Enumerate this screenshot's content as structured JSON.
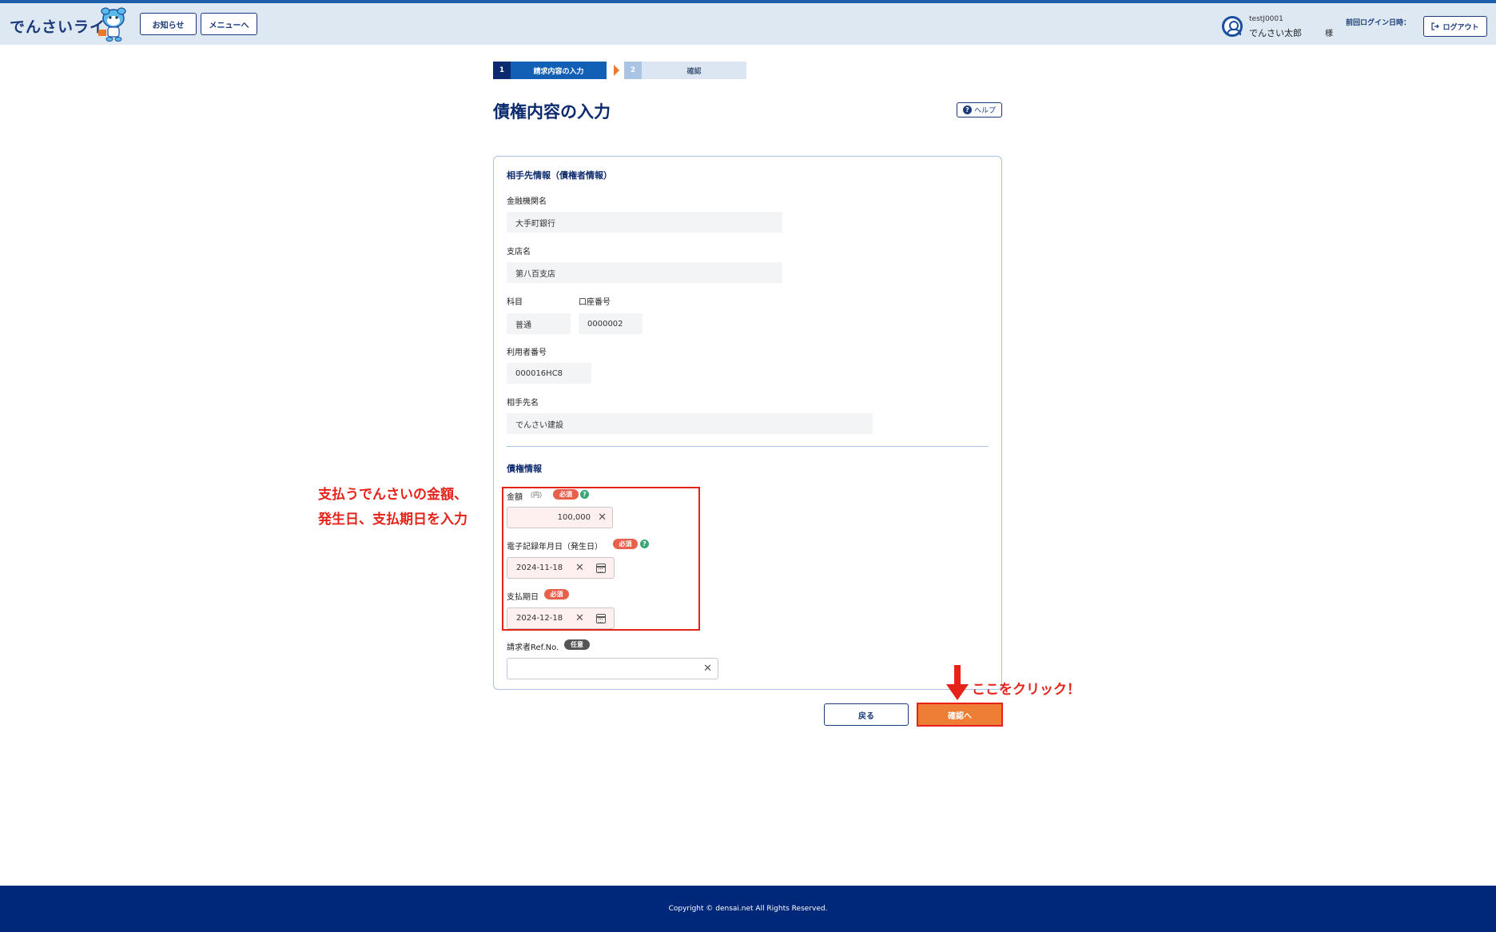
{
  "header": {
    "logo": "でんさいライト",
    "notice_button": "お知らせ",
    "menu_button": "メニューへ",
    "user_id": "testJ0001",
    "user_name": "でんさい太郎",
    "honorific": "様",
    "last_login_label": "前回ログイン日時：",
    "logout_button": "ログアウト"
  },
  "stepper": {
    "step1_num": "1",
    "step1_label": "請求内容の入力",
    "step2_num": "2",
    "step2_label": "確認"
  },
  "page": {
    "title": "債権内容の入力",
    "help_button": "ヘルプ"
  },
  "counterparty": {
    "section_title": "相手先情報（債権者情報）",
    "bank_label": "金融機関名",
    "bank_value": "大手町銀行",
    "branch_label": "支店名",
    "branch_value": "第八百支店",
    "account_type_label": "科目",
    "account_type_value": "普通",
    "account_number_label": "口座番号",
    "account_number_value": "0000002",
    "user_number_label": "利用者番号",
    "user_number_value": "000016HC8",
    "name_label": "相手先名",
    "name_value": "でんさい建設"
  },
  "claim": {
    "section_title": "債権情報",
    "amount_label": "金額",
    "amount_unit": "（円）",
    "amount_value": "100,000",
    "record_date_label": "電子記録年月日（発生日）",
    "record_date_value": "2024-11-18",
    "due_date_label": "支払期日",
    "due_date_value": "2024-12-18",
    "ref_label": "請求者Ref.No.",
    "ref_value": "",
    "required_badge": "必須",
    "optional_badge": "任意"
  },
  "annotations": {
    "input_line1": "支払うでんさいの金額、",
    "input_line2": "発生日、支払期日を入力",
    "click_here": "ここをクリック！"
  },
  "actions": {
    "back_button": "戻る",
    "confirm_button": "確認へ"
  },
  "footer": {
    "copyright": "Copyright © densai.net All Rights Reserved."
  },
  "icons": {
    "user": "user-circle-icon",
    "logout": "logout-icon",
    "help": "question-icon",
    "clear": "close-icon",
    "calendar": "calendar-icon",
    "annotation_arrow": "arrow-down-icon"
  },
  "colors": {
    "header_bg": "#dde8f3",
    "primary_navy": "#0c2a6e",
    "step_active": "#1160b5",
    "confirm_orange": "#ee7d35",
    "annotation_red": "#e5231b",
    "footer_bg": "#00287a",
    "required_badge": "#e8604c"
  }
}
